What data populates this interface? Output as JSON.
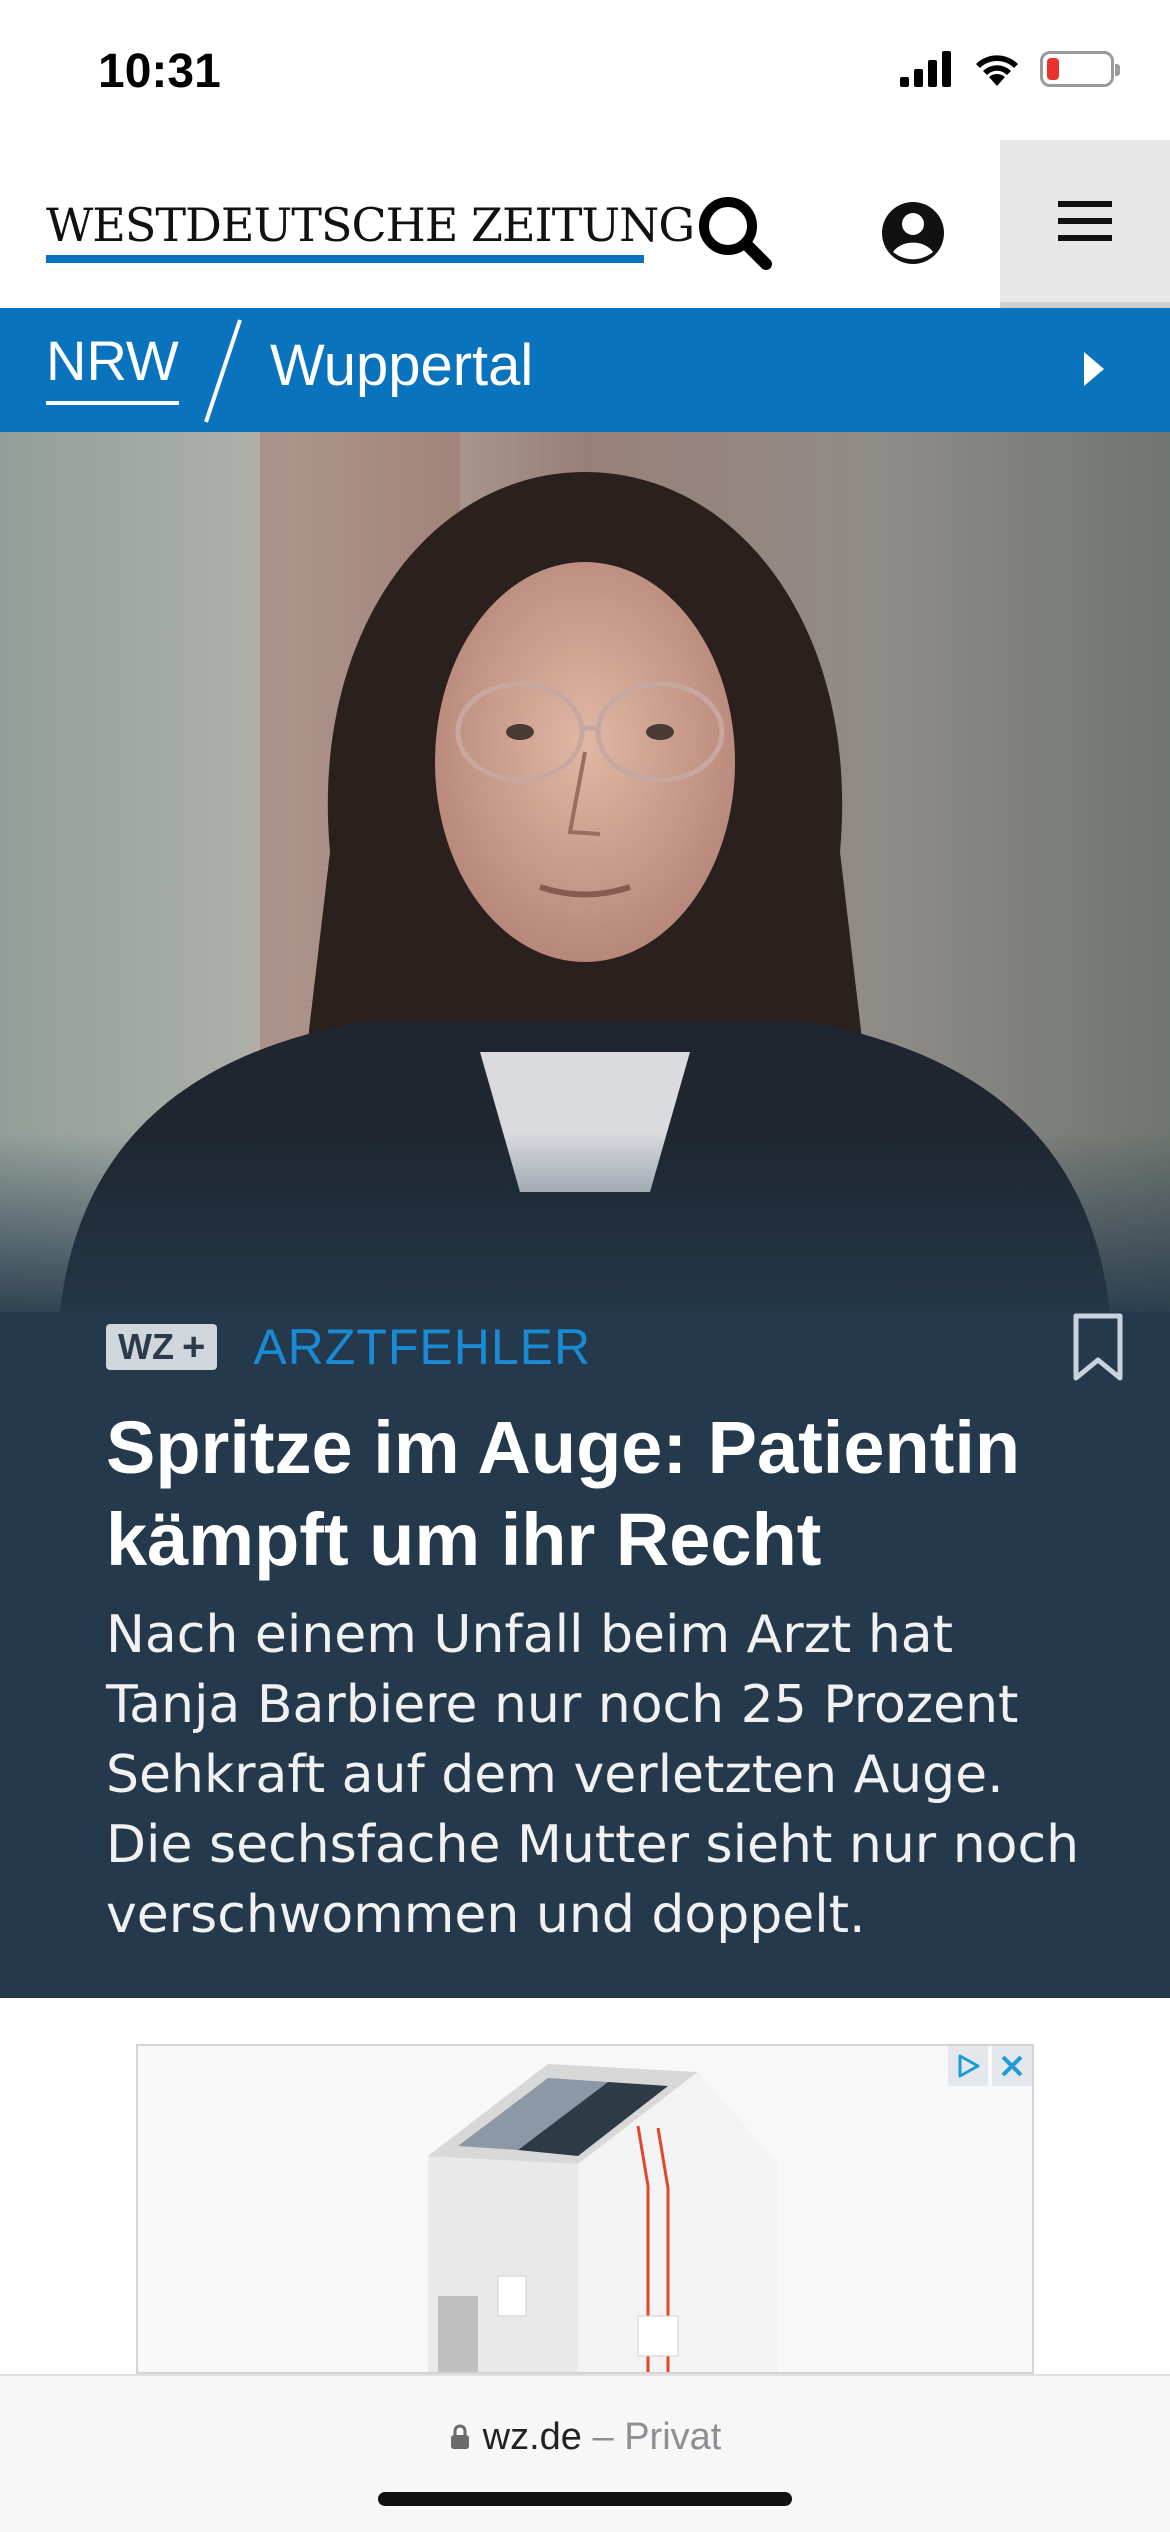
{
  "status_bar": {
    "time": "10:31"
  },
  "header": {
    "logo_text": "WESTDEUTSCHE ZEITUNG",
    "brand_color": "#0a73bd"
  },
  "breadcrumb": {
    "items": [
      "NRW",
      "Wuppertal"
    ]
  },
  "article": {
    "badge": "WZ",
    "badge_plus": "+",
    "kicker": "ARZTFEHLER",
    "headline": "Spritze im Auge: Patientin kämpft um ihr Recht",
    "teaser": "Nach einem Unfall beim Arzt hat Tanja Barbiere nur noch 25 Prozent Sehkraft auf dem verletzten Auge. Die sechsfache Mutter sieht nur noch verschwommen und doppelt.",
    "panel_color": "#24394b",
    "kicker_color": "#1b8ad4"
  },
  "browser": {
    "domain": "wz.de",
    "separator": "–",
    "mode": "Privat"
  }
}
